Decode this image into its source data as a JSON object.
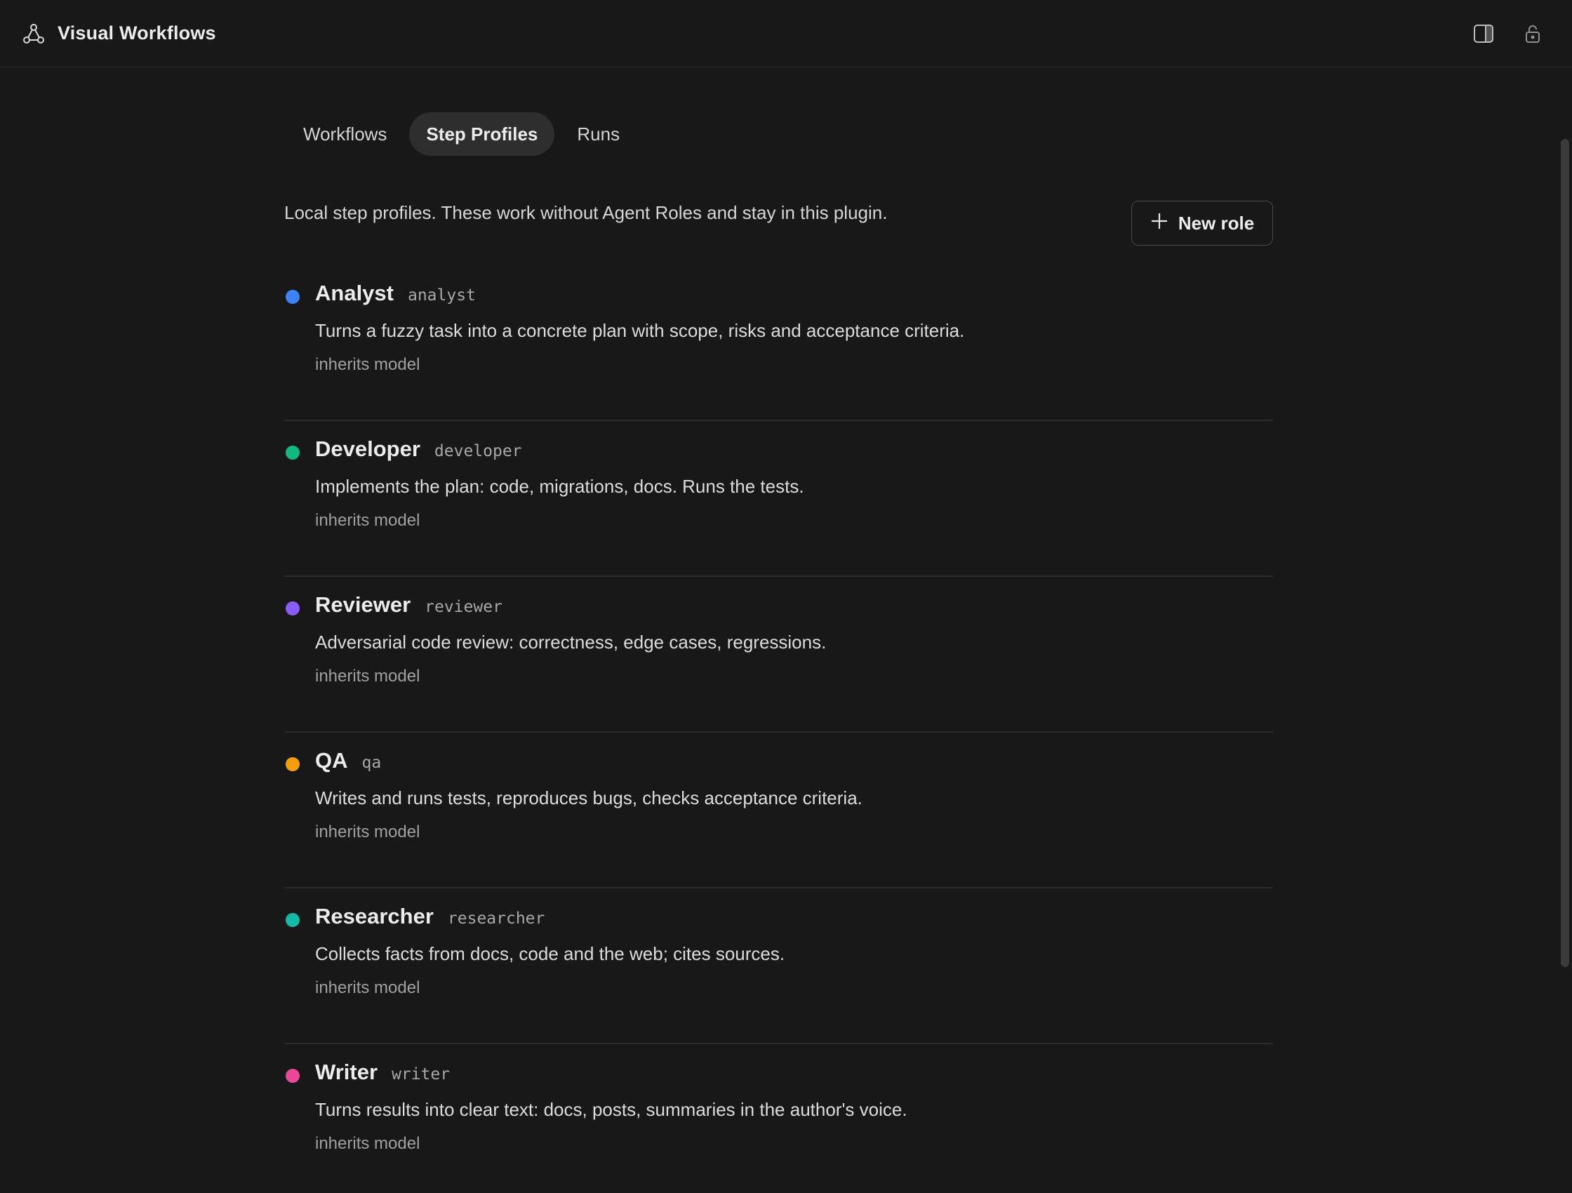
{
  "header": {
    "title": "Visual Workflows",
    "icons": {
      "app": "workflow-icon",
      "panel": "split-panel-icon",
      "lock": "unlock-icon"
    }
  },
  "tabs": [
    {
      "label": "Workflows",
      "active": false
    },
    {
      "label": "Step Profiles",
      "active": true
    },
    {
      "label": "Runs",
      "active": false
    }
  ],
  "intro": {
    "text": "Local step profiles. These work without Agent Roles and stay in this plugin.",
    "new_role_label": "New role",
    "new_role_icon": "plus-icon"
  },
  "roles": [
    {
      "name": "Analyst",
      "key": "analyst",
      "color": "#3b82f6",
      "description": "Turns a fuzzy task into a concrete plan with scope, risks and acceptance criteria.",
      "model": "inherits model"
    },
    {
      "name": "Developer",
      "key": "developer",
      "color": "#10b981",
      "description": "Implements the plan: code, migrations, docs. Runs the tests.",
      "model": "inherits model"
    },
    {
      "name": "Reviewer",
      "key": "reviewer",
      "color": "#8b5cf6",
      "description": "Adversarial code review: correctness, edge cases, regressions.",
      "model": "inherits model"
    },
    {
      "name": "QA",
      "key": "qa",
      "color": "#f59e0b",
      "description": "Writes and runs tests, reproduces bugs, checks acceptance criteria.",
      "model": "inherits model"
    },
    {
      "name": "Researcher",
      "key": "researcher",
      "color": "#14b8a6",
      "description": "Collects facts from docs, code and the web; cites sources.",
      "model": "inherits model"
    },
    {
      "name": "Writer",
      "key": "writer",
      "color": "#ec4899",
      "description": "Turns results into clear text: docs, posts, summaries in the author's voice.",
      "model": "inherits model"
    }
  ]
}
